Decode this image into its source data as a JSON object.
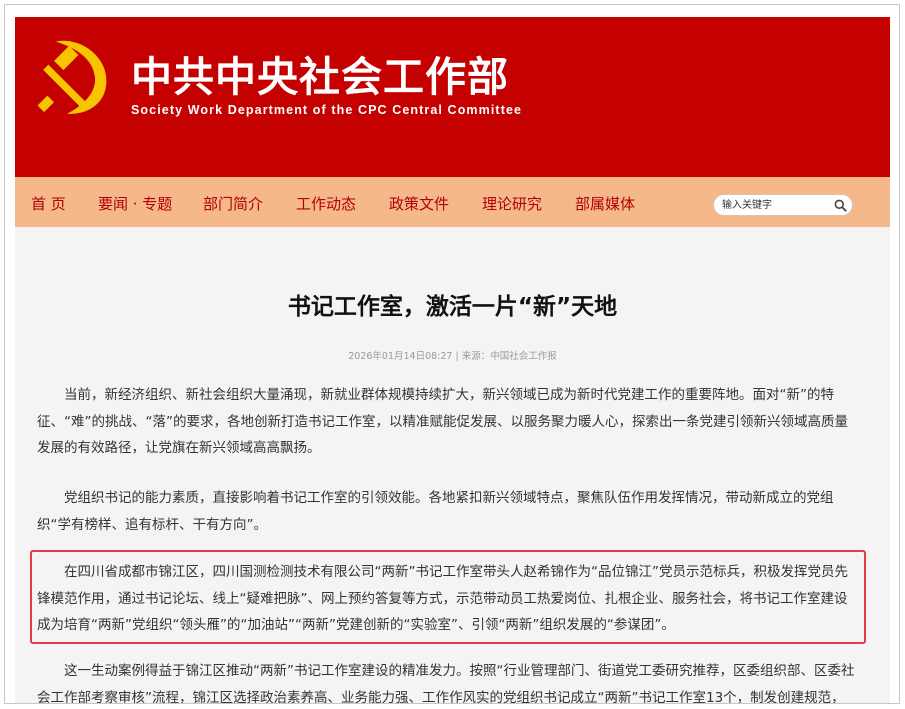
{
  "header": {
    "title_cn": "中共中央社会工作部",
    "title_en": "Society Work Department of the CPC Central Committee",
    "emblem_color": "#f6c400",
    "banner_color": "#c40000"
  },
  "nav": {
    "items": [
      "首 页",
      "要闻 · 专题",
      "部门简介",
      "工作动态",
      "政策文件",
      "理论研究",
      "部属媒体"
    ],
    "background": "#f5b88a",
    "text_color": "#b30000"
  },
  "search": {
    "placeholder": "输入关键字",
    "icon": "search-icon"
  },
  "article": {
    "title": "书记工作室，激活一片“新”天地",
    "meta": "2026年01月14日08:27 | 来源：中国社会工作报",
    "paragraphs": [
      "当前，新经济组织、新社会组织大量涌现，新就业群体规模持续扩大，新兴领域已成为新时代党建工作的重要阵地。面对“新”的特征、“难”的挑战、“落”的要求，各地创新打造书记工作室，以精准赋能促发展、以服务聚力暖人心，探索出一条党建引领新兴领域高质量发展的有效路径，让党旗在新兴领域高高飘扬。",
      "党组织书记的能力素质，直接影响着书记工作室的引领效能。各地紧扣新兴领域特点，聚焦队伍作用发挥情况，带动新成立的党组织“学有榜样、追有标杆、干有方向”。",
      "在四川省成都市锦江区，四川国测检测技术有限公司“两新”书记工作室带头人赵希锦作为“品位锦江”党员示范标兵，积极发挥党员先锋模范作用，通过书记论坛、线上“疑难把脉”、网上预约答复等方式，示范带动员工热爱岗位、扎根企业、服务社会，将书记工作室建设成为培育“两新”党组织“领头雁”的“加油站”“两新”党建创新的“实验室”、引领“两新”组织发展的“参谋团”。",
      "这一生动案例得益于锦江区推动“两新”书记工作室建设的精准发力。按照“行业管理部门、街道党工委研究推荐，区委组织部、区委社会工作部考察审核”流程，锦江区选择政治素养高、业务能力强、工作作风实的党组织书记成立“两新”书记工作室13个，制发创建规范，细化政治建设、人"
    ],
    "highlight_color": "#e53945"
  }
}
